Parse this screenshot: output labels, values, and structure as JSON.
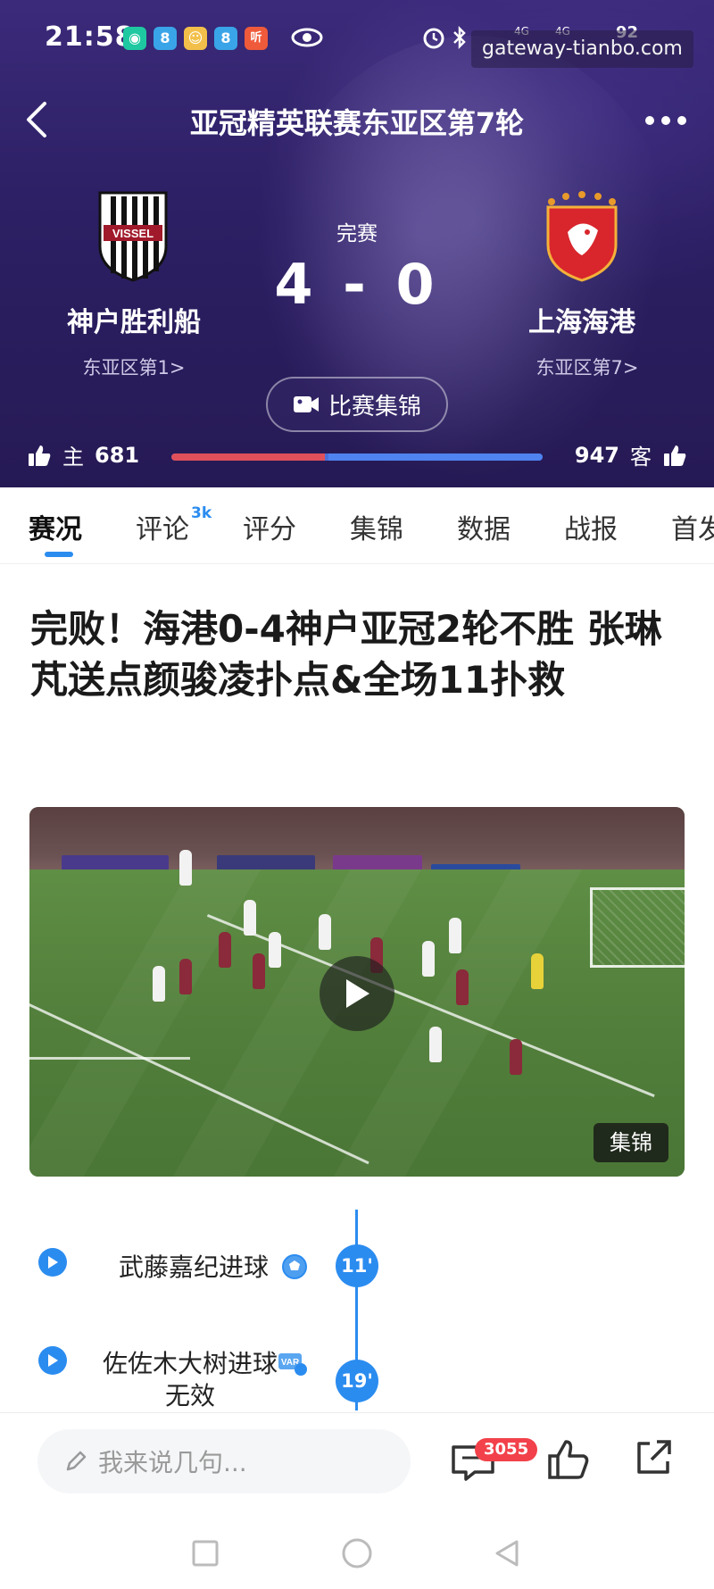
{
  "status_bar": {
    "time": "21:58",
    "battery": "92",
    "network": [
      "4G",
      "4G"
    ]
  },
  "watermark": "gateway-tianbo.com",
  "nav": {
    "title": "亚冠精英联赛东亚区第7轮"
  },
  "match": {
    "status": "完赛",
    "score": "4 - 0",
    "home": {
      "name": "神户胜利船",
      "rank": "东亚区第1>",
      "logo_text": "VISSEL"
    },
    "away": {
      "name": "上海海港",
      "rank": "东亚区第7>"
    },
    "highlight_label": "比赛集锦"
  },
  "likes": {
    "home_label": "主",
    "home_count": "681",
    "away_label": "客",
    "away_count": "947",
    "home_share": 0.418
  },
  "tabs": [
    {
      "label": "赛况",
      "active": true
    },
    {
      "label": "评论",
      "badge": "3k"
    },
    {
      "label": "评分"
    },
    {
      "label": "集锦"
    },
    {
      "label": "数据"
    },
    {
      "label": "战报"
    },
    {
      "label": "首发"
    }
  ],
  "article": {
    "headline": "完败！海港0-4神户亚冠2轮不胜 张琳芃送点颜骏凌扑点&全场11扑救",
    "video_tag": "集锦"
  },
  "timeline": [
    {
      "minute": "11'",
      "text": "武藤嘉纪进球",
      "icon": "soccer-ball-icon"
    },
    {
      "minute": "19'",
      "text": "佐佐木大树进球无效",
      "icon": "var-icon"
    }
  ],
  "bottom_bar": {
    "comment_placeholder": "我来说几句...",
    "comment_count": "3055"
  },
  "colors": {
    "accent": "#2b8cf0",
    "header_bg": "#2c1f63",
    "home_bar": "#e0505a",
    "away_bar": "#4f83f0",
    "badge": "#f2414a"
  }
}
